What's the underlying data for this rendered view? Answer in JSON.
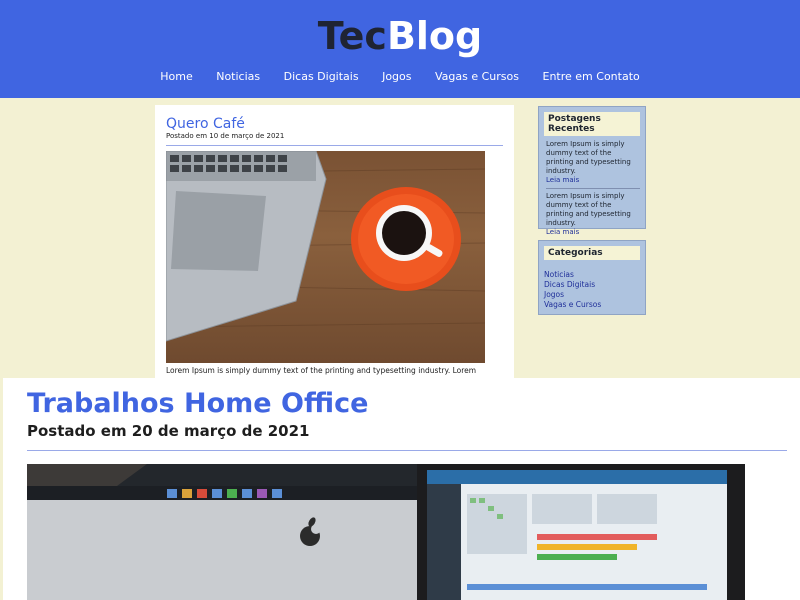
{
  "header": {
    "logo_part1": "Tec",
    "logo_part2": "Blog",
    "nav": [
      "Home",
      "Noticias",
      "Dicas Digitais",
      "Jogos",
      "Vagas e Cursos",
      "Entre em Contato"
    ]
  },
  "post1": {
    "title": "Quero Café",
    "date": "Postado em 10 de março de 2021",
    "excerpt": "Lorem Ipsum is simply dummy text of the printing and typesetting industry. Lorem"
  },
  "sidebar": {
    "recent_title": "Postagens Recentes",
    "recent_posts": [
      {
        "text": "Lorem Ipsum is simply dummy text of the printing and typesetting industry.",
        "more": "Leia mais"
      },
      {
        "text": "Lorem Ipsum is simply dummy text of the printing and typesetting industry.",
        "more": "Leia mais"
      }
    ],
    "categories_title": "Categorias",
    "categories": [
      "Noticias",
      "Dicas Digitais",
      "Jogos",
      "Vagas e Cursos"
    ]
  },
  "post2": {
    "title": "Trabalhos Home Office",
    "date": "Postado em 20 de março de 2021"
  }
}
